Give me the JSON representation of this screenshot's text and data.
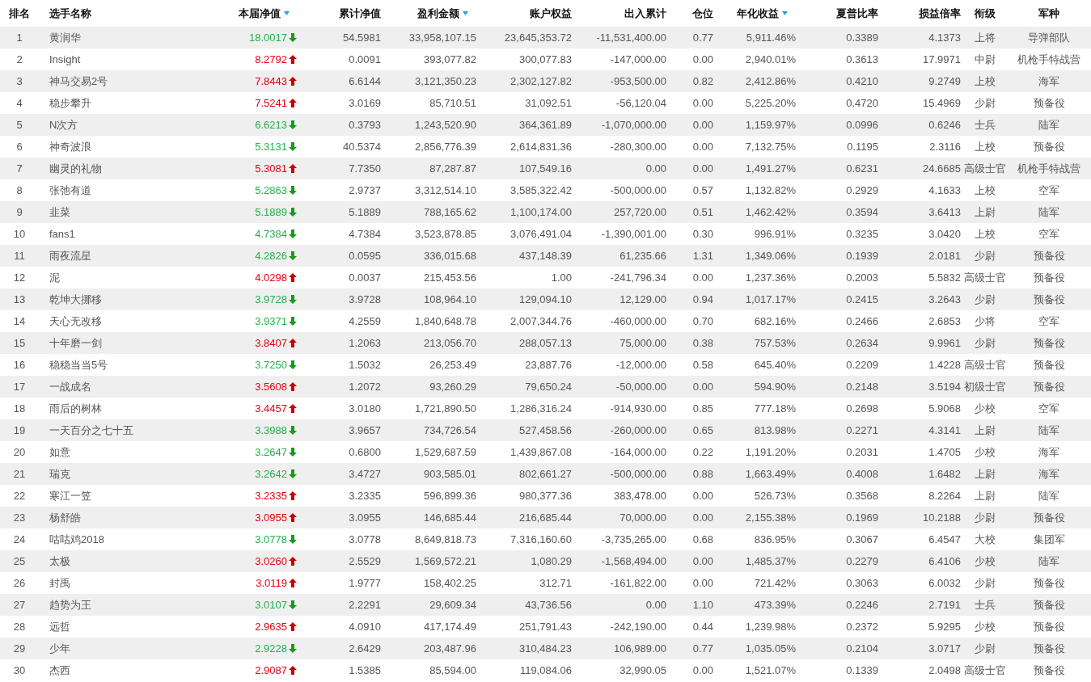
{
  "table": {
    "columns": [
      {
        "label": "排名",
        "sorted": false
      },
      {
        "label": "选手名称",
        "sorted": false
      },
      {
        "label": "本届净值",
        "sorted": true
      },
      {
        "label": "累计净值",
        "sorted": false
      },
      {
        "label": "盈利金额",
        "sorted": true
      },
      {
        "label": "账户权益",
        "sorted": false
      },
      {
        "label": "出入累计",
        "sorted": false
      },
      {
        "label": "仓位",
        "sorted": false
      },
      {
        "label": "年化收益",
        "sorted": true
      },
      {
        "label": "夏普比率",
        "sorted": false
      },
      {
        "label": "损益倍率",
        "sorted": false
      },
      {
        "label": "衔级",
        "sorted": false
      },
      {
        "label": "军种",
        "sorted": false
      }
    ],
    "rows": [
      {
        "kind": "down",
        "cells": [
          "1",
          "黄润华",
          "18.0017",
          "54.5981",
          "33,958,107.15",
          "23,645,353.72",
          "-11,531,400.00",
          "0.77",
          "5,911.46%",
          "0.3389",
          "4.1373",
          "上将",
          "导弹部队"
        ]
      },
      {
        "kind": "up",
        "cells": [
          "2",
          "Insight",
          "8.2792",
          "0.0091",
          "393,077.82",
          "300,077.83",
          "-147,000.00",
          "0.00",
          "2,940.01%",
          "0.3613",
          "17.9971",
          "中尉",
          "机枪手特战营"
        ]
      },
      {
        "kind": "up",
        "cells": [
          "3",
          "神马交易2号",
          "7.8443",
          "6.6144",
          "3,121,350.23",
          "2,302,127.82",
          "-953,500.00",
          "0.82",
          "2,412.86%",
          "0.4210",
          "9.2749",
          "上校",
          "海军"
        ]
      },
      {
        "kind": "up",
        "cells": [
          "4",
          "稳步攀升",
          "7.5241",
          "3.0169",
          "85,710.51",
          "31,092.51",
          "-56,120.04",
          "0.00",
          "5,225.20%",
          "0.4720",
          "15.4969",
          "少尉",
          "预备役"
        ]
      },
      {
        "kind": "down",
        "cells": [
          "5",
          "N次方",
          "6.6213",
          "0.3793",
          "1,243,520.90",
          "364,361.89",
          "-1,070,000.00",
          "0.00",
          "1,159.97%",
          "0.0996",
          "0.6246",
          "士兵",
          "陆军"
        ]
      },
      {
        "kind": "down",
        "cells": [
          "6",
          "神奇波浪",
          "5.3131",
          "40.5374",
          "2,856,776.39",
          "2,614,831.36",
          "-280,300.00",
          "0.00",
          "7,132.75%",
          "0.1195",
          "2.3116",
          "上校",
          "预备役"
        ]
      },
      {
        "kind": "up",
        "cells": [
          "7",
          "幽灵的礼物",
          "5.3081",
          "7.7350",
          "87,287.87",
          "107,549.16",
          "0.00",
          "0.00",
          "1,491.27%",
          "0.6231",
          "24.6685",
          "高级士官",
          "机枪手特战营"
        ]
      },
      {
        "kind": "down",
        "cells": [
          "8",
          "张弛有道",
          "5.2863",
          "2.9737",
          "3,312,514.10",
          "3,585,322.42",
          "-500,000.00",
          "0.57",
          "1,132.82%",
          "0.2929",
          "4.1633",
          "上校",
          "空军"
        ]
      },
      {
        "kind": "down",
        "cells": [
          "9",
          "韭菜",
          "5.1889",
          "5.1889",
          "788,165.62",
          "1,100,174.00",
          "257,720.00",
          "0.51",
          "1,462.42%",
          "0.3594",
          "3.6413",
          "上尉",
          "陆军"
        ]
      },
      {
        "kind": "down",
        "cells": [
          "10",
          "fans1",
          "4.7384",
          "4.7384",
          "3,523,878.85",
          "3,076,491.04",
          "-1,390,001.00",
          "0.30",
          "996.91%",
          "0.3235",
          "3.0420",
          "上校",
          "空军"
        ]
      },
      {
        "kind": "down",
        "cells": [
          "11",
          "雨夜流星",
          "4.2826",
          "0.0595",
          "336,015.68",
          "437,148.39",
          "61,235.66",
          "1.31",
          "1,349.06%",
          "0.1939",
          "2.0181",
          "少尉",
          "预备役"
        ]
      },
      {
        "kind": "up",
        "cells": [
          "12",
          "泥",
          "4.0298",
          "0.0037",
          "215,453.56",
          "1.00",
          "-241,796.34",
          "0.00",
          "1,237.36%",
          "0.2003",
          "5.5832",
          "高级士官",
          "预备役"
        ]
      },
      {
        "kind": "down",
        "cells": [
          "13",
          "乾坤大挪移",
          "3.9728",
          "3.9728",
          "108,964.10",
          "129,094.10",
          "12,129.00",
          "0.94",
          "1,017.17%",
          "0.2415",
          "3.2643",
          "少尉",
          "预备役"
        ]
      },
      {
        "kind": "down",
        "cells": [
          "14",
          "天心无改移",
          "3.9371",
          "4.2559",
          "1,840,648.78",
          "2,007,344.76",
          "-460,000.00",
          "0.70",
          "682.16%",
          "0.2466",
          "2.6853",
          "少将",
          "空军"
        ]
      },
      {
        "kind": "up",
        "cells": [
          "15",
          "十年磨一剑",
          "3.8407",
          "1.2063",
          "213,056.70",
          "288,057.13",
          "75,000.00",
          "0.38",
          "757.53%",
          "0.2634",
          "9.9961",
          "少尉",
          "预备役"
        ]
      },
      {
        "kind": "down",
        "cells": [
          "16",
          "稳稳当当5号",
          "3.7250",
          "1.5032",
          "26,253.49",
          "23,887.76",
          "-12,000.00",
          "0.58",
          "645.40%",
          "0.2209",
          "1.4228",
          "高级士官",
          "预备役"
        ]
      },
      {
        "kind": "up",
        "cells": [
          "17",
          "一战成名",
          "3.5608",
          "1.2072",
          "93,260.29",
          "79,650.24",
          "-50,000.00",
          "0.00",
          "594.90%",
          "0.2148",
          "3.5194",
          "初级士官",
          "预备役"
        ]
      },
      {
        "kind": "up",
        "cells": [
          "18",
          "雨后的树林",
          "3.4457",
          "3.0180",
          "1,721,890.50",
          "1,286,316.24",
          "-914,930.00",
          "0.85",
          "777.18%",
          "0.2698",
          "5.9068",
          "少校",
          "空军"
        ]
      },
      {
        "kind": "down",
        "cells": [
          "19",
          "一天百分之七十五",
          "3.3988",
          "3.9657",
          "734,726.54",
          "527,458.56",
          "-260,000.00",
          "0.65",
          "813.98%",
          "0.2271",
          "4.3141",
          "上尉",
          "陆军"
        ]
      },
      {
        "kind": "down",
        "cells": [
          "20",
          "如意",
          "3.2647",
          "0.6800",
          "1,529,687.59",
          "1,439,867.08",
          "-164,000.00",
          "0.22",
          "1,191.20%",
          "0.2031",
          "1.4705",
          "少校",
          "海军"
        ]
      },
      {
        "kind": "down",
        "cells": [
          "21",
          "瑞克",
          "3.2642",
          "3.4727",
          "903,585.01",
          "802,661.27",
          "-500,000.00",
          "0.88",
          "1,663.49%",
          "0.4008",
          "1.6482",
          "上尉",
          "海军"
        ]
      },
      {
        "kind": "up",
        "cells": [
          "22",
          "寒江一笠",
          "3.2335",
          "3.2335",
          "596,899.36",
          "980,377.36",
          "383,478.00",
          "0.00",
          "526.73%",
          "0.3568",
          "8.2264",
          "上尉",
          "陆军"
        ]
      },
      {
        "kind": "up",
        "cells": [
          "23",
          "杨舒皓",
          "3.0955",
          "3.0955",
          "146,685.44",
          "216,685.44",
          "70,000.00",
          "0.00",
          "2,155.38%",
          "0.1969",
          "10.2188",
          "少尉",
          "预备役"
        ]
      },
      {
        "kind": "down",
        "cells": [
          "24",
          "咕咕鸡2018",
          "3.0778",
          "3.0778",
          "8,649,818.73",
          "7,316,160.60",
          "-3,735,265.00",
          "0.68",
          "836.95%",
          "0.3067",
          "6.4547",
          "大校",
          "集团军"
        ]
      },
      {
        "kind": "up",
        "cells": [
          "25",
          "太极",
          "3.0260",
          "2.5529",
          "1,569,572.21",
          "1,080.29",
          "-1,568,494.00",
          "0.00",
          "1,485.37%",
          "0.2279",
          "6.4106",
          "少校",
          "陆军"
        ]
      },
      {
        "kind": "up",
        "cells": [
          "26",
          "封禹",
          "3.0119",
          "1.9777",
          "158,402.25",
          "312.71",
          "-161,822.00",
          "0.00",
          "721.42%",
          "0.3063",
          "6.0032",
          "少尉",
          "预备役"
        ]
      },
      {
        "kind": "down",
        "cells": [
          "27",
          "趋势为王",
          "3.0107",
          "2.2291",
          "29,609.34",
          "43,736.56",
          "0.00",
          "1.10",
          "473.39%",
          "0.2246",
          "2.7191",
          "士兵",
          "预备役"
        ]
      },
      {
        "kind": "up",
        "cells": [
          "28",
          "远哲",
          "2.9635",
          "4.0910",
          "417,174.49",
          "251,791.43",
          "-242,190.00",
          "0.44",
          "1,239.98%",
          "0.2372",
          "5.9295",
          "少校",
          "预备役"
        ]
      },
      {
        "kind": "down",
        "cells": [
          "29",
          "少年",
          "2.9228",
          "2.6429",
          "203,487.96",
          "310,484.23",
          "106,989.00",
          "0.77",
          "1,035.05%",
          "0.2104",
          "3.0717",
          "少尉",
          "预备役"
        ]
      },
      {
        "kind": "up",
        "cells": [
          "30",
          "杰西",
          "2.9087",
          "1.5385",
          "85,594.00",
          "119,084.06",
          "32,990.05",
          "0.00",
          "1,521.07%",
          "0.1339",
          "2.0498",
          "高级士官",
          "预备役"
        ]
      }
    ]
  }
}
